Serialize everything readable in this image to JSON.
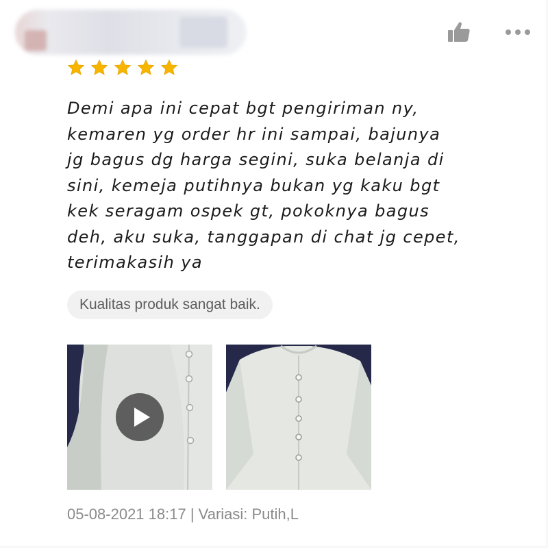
{
  "review": {
    "reviewer_name": "",
    "rating": 5,
    "rating_max": 5,
    "text": "Demi apa ini cepat bgt pengiriman ny,\nkemaren yg order hr ini sampai, bajunya\njg bagus dg harga segini, suka belanja di\nsini, kemeja putihnya bukan yg kaku bgt\nkek seragam ospek gt, pokoknya bagus\ndeh, aku suka, tanggapan di chat jg cepet,\nterimakasih ya",
    "quality_tag": "Kualitas produk sangat baik.",
    "timestamp": "05-08-2021 18:17",
    "separator": "|",
    "variation": "Variasi: Putih,L"
  },
  "icons": {
    "like": "thumbs-up-icon",
    "more": "more-horizontal-icon",
    "star": "star-icon",
    "play": "play-icon"
  },
  "colors": {
    "star": "#f7b500",
    "icon_gray": "#9a9a9a",
    "text": "#1b1b1b",
    "meta": "#8a8a8a",
    "tag_bg": "#f1f1f1"
  },
  "media": [
    {
      "type": "video",
      "subject": "white shirt close-up"
    },
    {
      "type": "photo",
      "subject": "white shirt"
    }
  ]
}
